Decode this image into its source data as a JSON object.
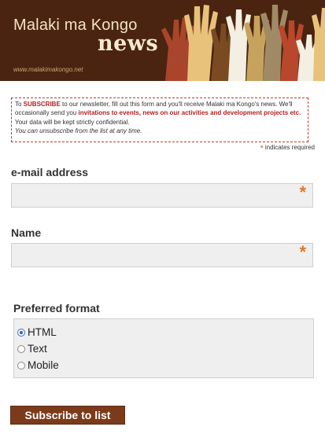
{
  "header": {
    "title": "Malaki ma Kongo",
    "news": "news",
    "url": "www.malakimakongo.net",
    "colors": {
      "background": "#4a2410",
      "title": "#f1e3c6"
    }
  },
  "notice": {
    "p1": "To ",
    "p1_bold": "SUBSCRIBE",
    "p2": " to our newsletter, fill out this form and you'll receive Malaki ma Kongo's news. We'll occasionally send you ",
    "p2_bold": "invitations to events, news on our activities and development projects etc.",
    "line3": "Your data will be kept strictly confidential.",
    "line4": "You can unsubscribe from the list at any time."
  },
  "required_note": {
    "star": "*",
    "text": "indicates required"
  },
  "form": {
    "email": {
      "label": "e-mail address",
      "value": "",
      "required_mark": "*"
    },
    "name": {
      "label": "Name",
      "value": "",
      "required_mark": "*"
    },
    "format": {
      "label": "Preferred format",
      "options": [
        {
          "label": "HTML",
          "selected": true
        },
        {
          "label": "Text",
          "selected": false
        },
        {
          "label": "Mobile",
          "selected": false
        }
      ]
    },
    "submit_label": "Subscribe to list"
  }
}
